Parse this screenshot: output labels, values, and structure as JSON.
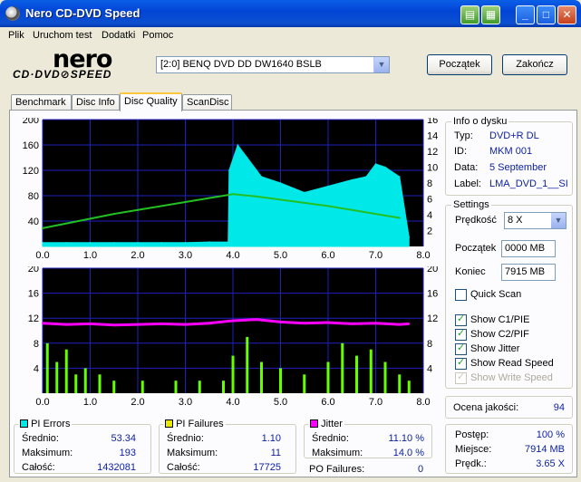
{
  "window": {
    "title": "Nero CD-DVD Speed"
  },
  "titlebar_buttons": {
    "minimize": "_",
    "maximize": "□",
    "close": "✕"
  },
  "menu": [
    "Plik",
    "Uruchom test",
    "Dodatki",
    "Pomoc"
  ],
  "logo": {
    "main": "nero",
    "sub": "CD·DVD⊘SPEED"
  },
  "drive": {
    "selected": "[2:0]  BENQ DVD DD DW1640 BSLB"
  },
  "buttons": {
    "start": "Początek",
    "end": "Zakończ"
  },
  "tabs": [
    "Benchmark",
    "Disc Info",
    "Disc Quality",
    "ScanDisc"
  ],
  "disc_info": {
    "title": "Info o dysku",
    "rows": [
      {
        "label": "Typ:",
        "value": "DVD+R DL"
      },
      {
        "label": "ID:",
        "value": "MKM 001"
      },
      {
        "label": "Data:",
        "value": "5 September"
      },
      {
        "label": "Label:",
        "value": "LMA_DVD_1__SI"
      }
    ]
  },
  "settings": {
    "title": "Settings",
    "speed_label": "Prędkość",
    "speed_value": "8 X",
    "start_label": "Początek",
    "start_value": "0000 MB",
    "end_label": "Koniec",
    "end_value": "7915 MB",
    "quick_scan": {
      "label": "Quick Scan",
      "checked": false
    },
    "checks": [
      {
        "label": "Show C1/PIE",
        "checked": true,
        "disabled": false
      },
      {
        "label": "Show C2/PIF",
        "checked": true,
        "disabled": false
      },
      {
        "label": "Show Jitter",
        "checked": true,
        "disabled": false
      },
      {
        "label": "Show Read Speed",
        "checked": true,
        "disabled": false
      },
      {
        "label": "Show Write Speed",
        "checked": true,
        "disabled": true
      }
    ]
  },
  "quality": {
    "label": "Ocena jakości:",
    "value": "94"
  },
  "progress": {
    "rows": [
      {
        "label": "Postęp:",
        "value": "100 %"
      },
      {
        "label": "Miejsce:",
        "value": "7914 MB"
      },
      {
        "label": "Prędk.:",
        "value": "3.65 X"
      }
    ]
  },
  "pi_errors": {
    "title": "PI Errors",
    "color": "#00E8E8",
    "rows": [
      {
        "label": "Średnio:",
        "value": "53.34"
      },
      {
        "label": "Maksimum:",
        "value": "193"
      },
      {
        "label": "Całość:",
        "value": "1432081"
      }
    ]
  },
  "pi_failures": {
    "title": "PI Failures",
    "color": "#E8E800",
    "rows": [
      {
        "label": "Średnio:",
        "value": "1.10"
      },
      {
        "label": "Maksimum:",
        "value": "11"
      },
      {
        "label": "Całość:",
        "value": "17725"
      }
    ]
  },
  "jitter": {
    "title": "Jitter",
    "color": "#FF00FF",
    "rows": [
      {
        "label": "Średnio:",
        "value": "11.10 %"
      },
      {
        "label": "Maksimum:",
        "value": "14.0 %"
      }
    ]
  },
  "po_failures": {
    "label": "PO Failures:",
    "value": "0"
  },
  "chart_data": [
    {
      "type": "area",
      "name": "top",
      "xlim": [
        0,
        8
      ],
      "ylim": [
        0,
        200
      ],
      "y2lim": [
        0,
        16
      ],
      "x_ticks": [
        "0.0",
        "1.0",
        "2.0",
        "3.0",
        "4.0",
        "5.0",
        "6.0",
        "7.0",
        "8.0"
      ],
      "y_ticks": [
        "200",
        "160",
        "120",
        "80",
        "40"
      ],
      "y2_ticks": [
        "16",
        "14",
        "12",
        "10",
        "8",
        "6",
        "4",
        "2"
      ],
      "grid": true,
      "series": [
        {
          "name": "PI Errors",
          "color": "#00E8E8",
          "x": [
            0,
            0.5,
            1,
            1.5,
            2,
            2.5,
            3,
            3.5,
            3.9,
            3.92,
            4.1,
            4.3,
            4.6,
            5,
            5.5,
            6,
            6.5,
            6.8,
            7,
            7.2,
            7.5,
            7.7
          ],
          "y": [
            6,
            6,
            6,
            6,
            6,
            6,
            6,
            7,
            7,
            120,
            160,
            140,
            110,
            100,
            85,
            95,
            105,
            110,
            130,
            125,
            110,
            15
          ]
        },
        {
          "name": "Read Speed",
          "color": "#22C022",
          "axis": "right",
          "x": [
            0,
            0.5,
            1,
            1.5,
            2,
            2.5,
            3,
            3.5,
            4,
            4.5,
            5,
            5.5,
            6,
            6.5,
            7,
            7.5
          ],
          "y": [
            2.3,
            2.9,
            3.5,
            4.1,
            4.6,
            5.1,
            5.6,
            6.1,
            6.6,
            6.3,
            5.9,
            5.5,
            5.1,
            4.6,
            4.1,
            3.6
          ]
        }
      ]
    },
    {
      "type": "bar",
      "name": "bottom",
      "xlim": [
        0,
        8
      ],
      "ylim": [
        0,
        20
      ],
      "x_ticks": [
        "0.0",
        "1.0",
        "2.0",
        "3.0",
        "4.0",
        "5.0",
        "6.0",
        "7.0",
        "8.0"
      ],
      "y_ticks": [
        "20",
        "16",
        "12",
        "8",
        "4"
      ],
      "y2_ticks": [
        "20",
        "16",
        "12",
        "8",
        "4"
      ],
      "grid": true,
      "series": [
        {
          "name": "PI Failures",
          "color": "#66FF00",
          "x": [
            0.1,
            0.3,
            0.5,
            0.7,
            0.9,
            1.2,
            1.5,
            2.1,
            2.8,
            3.3,
            3.8,
            4.0,
            4.3,
            4.6,
            5.0,
            5.5,
            6.0,
            6.3,
            6.6,
            6.9,
            7.2,
            7.5,
            7.7
          ],
          "y": [
            8,
            5,
            7,
            3,
            4,
            3,
            2,
            2,
            2,
            2,
            2,
            6,
            9,
            5,
            4,
            3,
            5,
            8,
            6,
            7,
            5,
            3,
            2
          ]
        },
        {
          "name": "Jitter",
          "color": "#FF00FF",
          "type": "line",
          "x": [
            0,
            0.5,
            1,
            1.5,
            2,
            2.5,
            3,
            3.5,
            4,
            4.5,
            5,
            5.5,
            6,
            6.5,
            7,
            7.5,
            7.7
          ],
          "y": [
            11.2,
            11.0,
            11.1,
            10.9,
            11.0,
            11.1,
            11.0,
            11.2,
            11.6,
            11.8,
            11.4,
            11.2,
            11.3,
            11.1,
            11.2,
            11.0,
            11.1
          ]
        }
      ]
    }
  ]
}
